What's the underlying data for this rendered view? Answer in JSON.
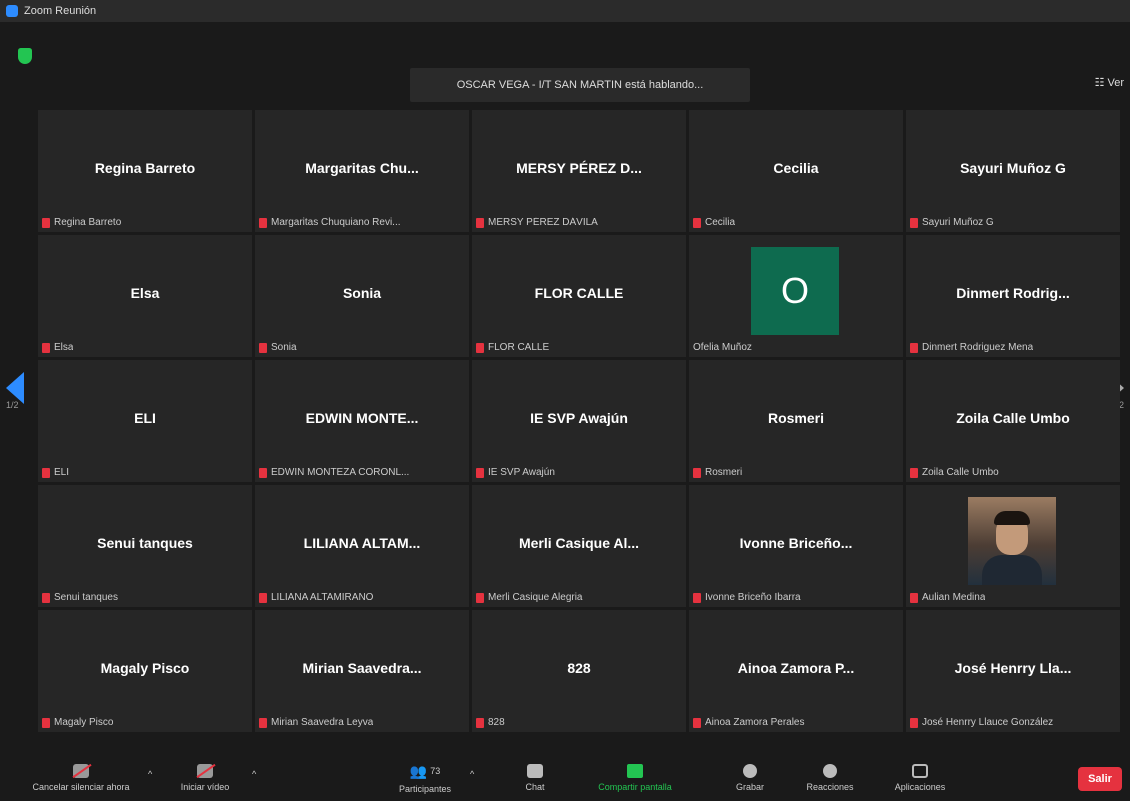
{
  "window": {
    "title": "Zoom Reunión"
  },
  "topbar": {
    "speaking": "OSCAR VEGA - I/T SAN MARTIN está hablando...",
    "view_label": "Ver"
  },
  "pagination": {
    "left": "1/2",
    "right": "1/2"
  },
  "participants": [
    {
      "display": "Regina Barreto",
      "label": "Regina Barreto",
      "muted": true
    },
    {
      "display": "Margaritas Chu...",
      "label": "Margaritas Chuquiano Revi...",
      "muted": true
    },
    {
      "display": "MERSY PÉREZ D...",
      "label": "MERSY PÉREZ DÁVILA",
      "muted": true
    },
    {
      "display": "Cecilia",
      "label": "Cecilia",
      "muted": true
    },
    {
      "display": "Sayuri Muñoz G",
      "label": "Sayuri Muñoz G",
      "muted": true
    },
    {
      "display": "Elsa",
      "label": "Elsa",
      "muted": true
    },
    {
      "display": "Sonia",
      "label": "Sonia",
      "muted": true
    },
    {
      "display": "FLOR CALLE",
      "label": "FLOR CALLE",
      "muted": true
    },
    {
      "display": "",
      "avatar_letter": "O",
      "label": "Ofelia Muñoz",
      "muted": false
    },
    {
      "display": "Dinmert Rodrig...",
      "label": "Dinmert Rodriguez Mena",
      "muted": true
    },
    {
      "display": "ELI",
      "label": "ELI",
      "muted": true
    },
    {
      "display": "EDWIN MONTE...",
      "label": "EDWIN MONTEZA CORONL...",
      "muted": true
    },
    {
      "display": "IE SVP Awajún",
      "label": "IE SVP Awajún",
      "muted": true
    },
    {
      "display": "Rosmeri",
      "label": "Rosmeri",
      "muted": true
    },
    {
      "display": "Zoila Calle Umbo",
      "label": "Zoila Calle Umbo",
      "muted": true
    },
    {
      "display": "Senui tanques",
      "label": "Senui tanques",
      "muted": true
    },
    {
      "display": "LILIANA ALTAM...",
      "label": "LILIANA ALTAMIRANO",
      "muted": true
    },
    {
      "display": "Merli Casique Al...",
      "label": "Merli Casique Alegria",
      "muted": true
    },
    {
      "display": "Ivonne Briceño...",
      "label": "Ivonne Briceño Ibarra",
      "muted": true
    },
    {
      "display": "",
      "photo": true,
      "label": "Aulian Medina",
      "muted": true
    },
    {
      "display": "Magaly Pisco",
      "label": "Magaly Pisco",
      "muted": true
    },
    {
      "display": "Mirian Saavedra...",
      "label": "Mirian Saavedra Leyva",
      "muted": true
    },
    {
      "display": "828",
      "label": "828",
      "muted": true
    },
    {
      "display": "Ainoa Zamora P...",
      "label": "Ainoa Zamora Perales",
      "muted": true
    },
    {
      "display": "José Henrry Lla...",
      "label": "José Henrry Llauce González",
      "muted": true
    }
  ],
  "toolbar": {
    "unmute": "Cancelar silenciar ahora",
    "start_video": "Iniciar vídeo",
    "participants": "Participantes",
    "participants_count": "73",
    "chat": "Chat",
    "share": "Compartir pantalla",
    "record": "Grabar",
    "reactions": "Reacciones",
    "apps": "Aplicaciones",
    "exit": "Salir"
  }
}
